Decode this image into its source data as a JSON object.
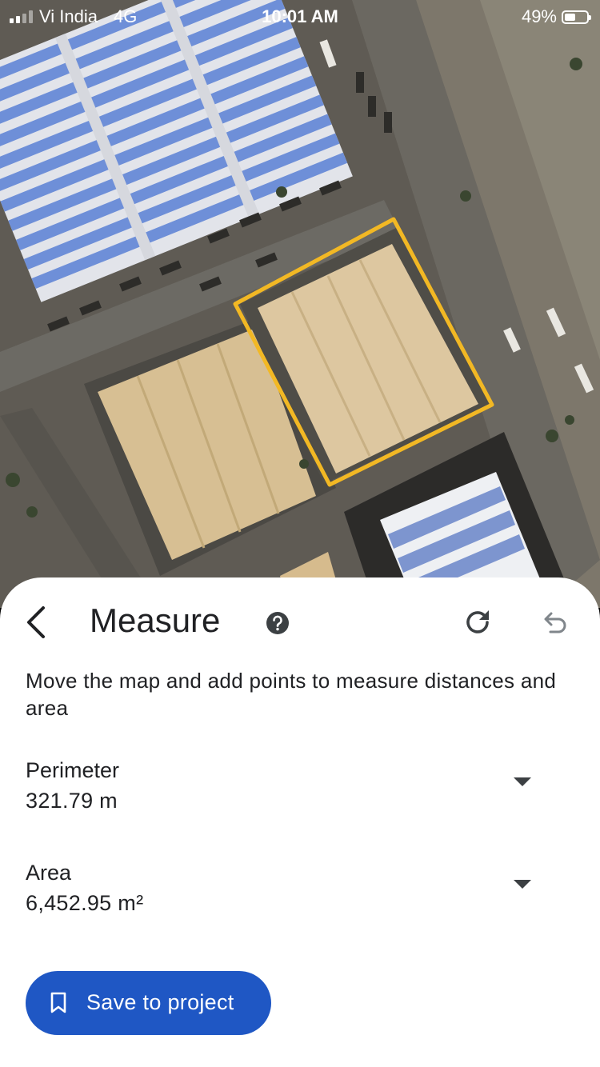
{
  "status_bar": {
    "carrier": "Vi India",
    "network": "4G",
    "time": "10:01 AM",
    "battery_percent": "49%",
    "battery_level": 0.49
  },
  "map": {
    "view": "satellite",
    "measure_outline_color": "#f2b824"
  },
  "sheet": {
    "title": "Measure",
    "help_icon": "help-circle-icon",
    "back_icon": "chevron-left-icon",
    "redo_icon": "redo-icon",
    "undo_icon": "undo-icon",
    "description": "Move the map and add points to measure distances and area",
    "perimeter": {
      "label": "Perimeter",
      "value": "321.79 m"
    },
    "area": {
      "label": "Area",
      "value": "6,452.95 m²"
    },
    "save_button": {
      "label": "Save to project",
      "icon": "bookmark-icon"
    }
  },
  "colors": {
    "primary_button": "#1f57c4",
    "text": "#202124",
    "disabled_icon": "#80868b"
  }
}
